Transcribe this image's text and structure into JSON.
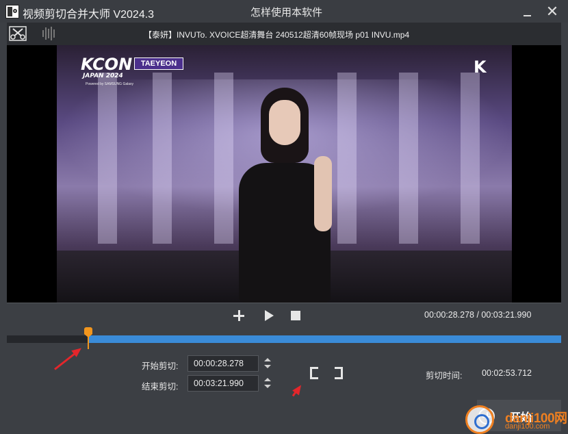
{
  "window": {
    "title": "视频剪切合并大师 V2024.3",
    "help_link": "怎样使用本软件",
    "close_symbol": "✕"
  },
  "toolbar": {
    "file_name": "【泰妍】INVUTo. XVOICE超清舞台 240512超清60帧现场 p01 INVU.mp4",
    "icons": [
      "cut-tool-icon",
      "waveform-icon"
    ]
  },
  "video": {
    "logo_text": "KCON",
    "logo_subtext": "JAPAN 2024",
    "sponsor_text": "Powered by SAMSUNG Galaxy",
    "artist_badge": "TAEYEON",
    "corner_logo": "K"
  },
  "playback": {
    "current_time": "00:00:28.278",
    "separator": " / ",
    "total_time": "00:03:21.990",
    "progress": 0.14,
    "colors": {
      "track": "#25272b",
      "selected": "#3a8bd8",
      "playhead": "#f2961e"
    }
  },
  "cut": {
    "start_label": "开始剪切:",
    "start_value": "00:00:28.278",
    "end_label": "结束剪切:",
    "end_value": "00:03:21.990",
    "duration_label": "剪切时间:",
    "duration_value": "00:02:53.712"
  },
  "start_button": {
    "label": "开始"
  },
  "watermark": {
    "brand": "danji100网",
    "url": "danji100.com"
  },
  "annotation_color": "#e3262b"
}
